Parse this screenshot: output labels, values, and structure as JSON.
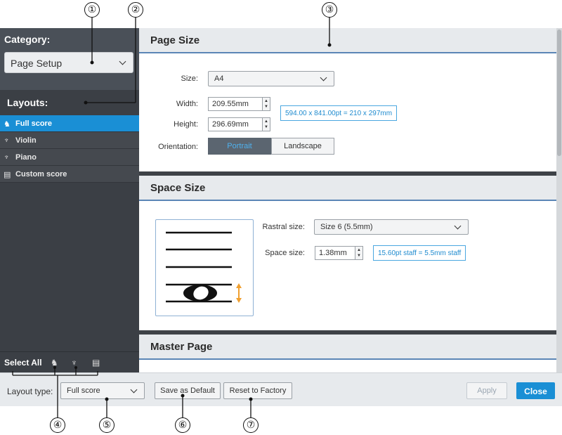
{
  "sidebar": {
    "category_label": "Category:",
    "category_value": "Page Setup",
    "layouts_label": "Layouts:",
    "layouts": [
      {
        "label": "Full score",
        "icon": "full-score-icon",
        "glyph": "♞",
        "active": true
      },
      {
        "label": "Violin",
        "icon": "part-icon",
        "glyph": "♆",
        "active": false
      },
      {
        "label": "Piano",
        "icon": "part-icon",
        "glyph": "♆",
        "active": false
      },
      {
        "label": "Custom score",
        "icon": "custom-score-icon",
        "glyph": "▤",
        "active": false
      }
    ],
    "select_all_label": "Select All",
    "select_all_icons": [
      {
        "icon": "full-score-icon",
        "glyph": "♞"
      },
      {
        "icon": "part-icon",
        "glyph": "♆"
      },
      {
        "icon": "custom-score-icon",
        "glyph": "▤"
      }
    ]
  },
  "page_size": {
    "title": "Page Size",
    "size_label": "Size:",
    "size_value": "A4",
    "width_label": "Width:",
    "width_value": "209.55mm",
    "height_label": "Height:",
    "height_value": "296.69mm",
    "dimensions_info": "594.00 x 841.00pt = 210 x 297mm",
    "orientation_label": "Orientation:",
    "portrait_label": "Portrait",
    "landscape_label": "Landscape",
    "selected_orientation": "Portrait"
  },
  "space_size": {
    "title": "Space Size",
    "rastral_label": "Rastral size:",
    "rastral_value": "Size 6 (5.5mm)",
    "space_label": "Space size:",
    "space_value": "1.38mm",
    "space_info": "15.60pt staff = 5.5mm staff"
  },
  "master_page": {
    "title": "Master Page"
  },
  "footer": {
    "layout_type_label": "Layout type:",
    "layout_type_value": "Full score",
    "save_default_label": "Save as Default",
    "reset_factory_label": "Reset to Factory",
    "apply_label": "Apply",
    "close_label": "Close"
  },
  "callouts": [
    "①",
    "②",
    "③",
    "④",
    "⑤",
    "⑥",
    "⑦"
  ],
  "colors": {
    "accent": "#1a8fd5",
    "sidebar_bg": "#3b3f45",
    "section_rule": "#5b86b6",
    "info_text": "#1f8bcf",
    "resize_arrow": "#f0a030"
  }
}
